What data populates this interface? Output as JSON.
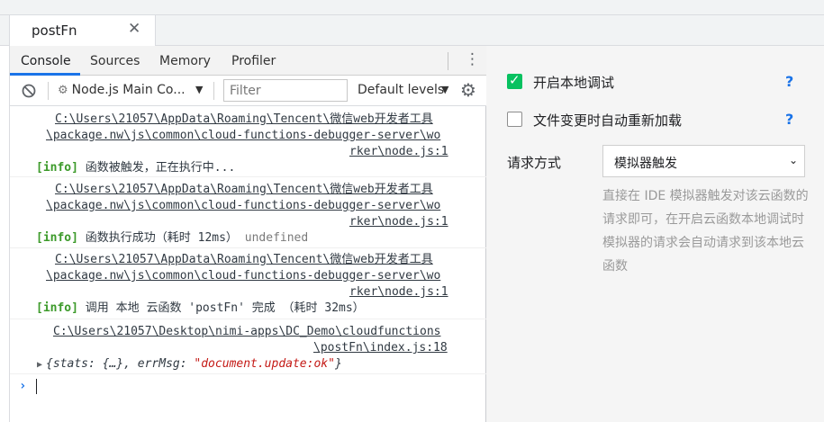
{
  "tab": {
    "title": "postFn",
    "close": "✕"
  },
  "devtools": {
    "tabs": [
      "Console",
      "Sources",
      "Memory",
      "Profiler"
    ],
    "menu": "⋮"
  },
  "toolbar": {
    "context": "Node.js Main Co...",
    "filter_placeholder": "Filter",
    "levels": "Default levels"
  },
  "console": {
    "messages": [
      {
        "source": [
          "C:\\Users\\21057\\AppData\\Roaming\\Tencent\\微信web开发者工具",
          "\\package.nw\\js\\common\\cloud-functions-debugger-server\\wo",
          "rker\\node.js:1"
        ],
        "tag": "[info]",
        "text": "函数被触发，正在执行中...",
        "extra": ""
      },
      {
        "source": [
          "C:\\Users\\21057\\AppData\\Roaming\\Tencent\\微信web开发者工具",
          "\\package.nw\\js\\common\\cloud-functions-debugger-server\\wo",
          "rker\\node.js:1"
        ],
        "tag": "[info]",
        "text": "函数执行成功（耗时 12ms）",
        "extra": "undefined"
      },
      {
        "source": [
          "C:\\Users\\21057\\AppData\\Roaming\\Tencent\\微信web开发者工具",
          "\\package.nw\\js\\common\\cloud-functions-debugger-server\\wo",
          "rker\\node.js:1"
        ],
        "tag": "[info]",
        "text": "调用 本地 云函数 'postFn' 完成  （耗时 32ms）",
        "extra": ""
      },
      {
        "source": [
          "C:\\Users\\21057\\Desktop\\nimi-apps\\DC_Demo\\cloudfunctions",
          "\\postFn\\index.js:18"
        ],
        "object": {
          "prefix": "{stats: {…}, errMsg: ",
          "value": "\"document.update:ok\"",
          "suffix": "}"
        }
      }
    ],
    "prompt": "›"
  },
  "right_panel": {
    "option1": {
      "label": "开启本地调试",
      "checked": true,
      "help": "?"
    },
    "option2": {
      "label": "文件变更时自动重新加载",
      "checked": false,
      "help": "?"
    },
    "request_label": "请求方式",
    "request_value": "模拟器触发",
    "description": "直接在 IDE 模拟器触发对该云函数的请求即可，在开启云函数本地调试时模拟器的请求会自动请求到该本地云函数"
  },
  "colors": {
    "accent": "#1a73e8",
    "checkbox": "#07c160",
    "info": "#3c9a2a",
    "string": "#c41a16"
  }
}
